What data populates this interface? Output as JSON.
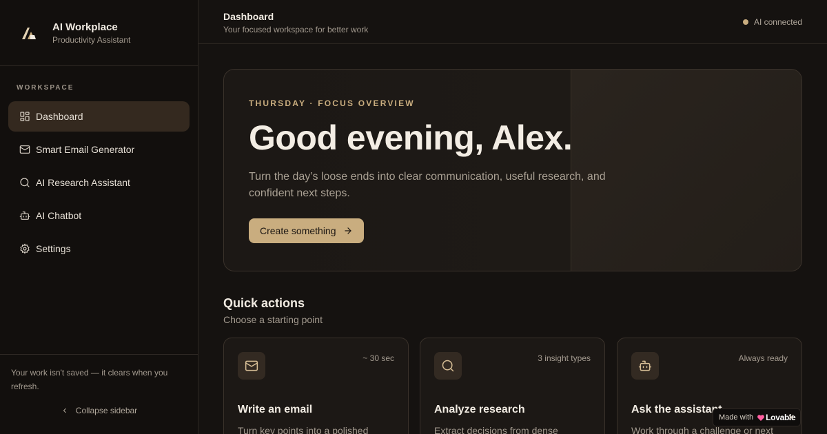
{
  "brand": {
    "title": "AI Workplace",
    "subtitle": "Productivity Assistant",
    "logo_icon": "workplace-logo-icon"
  },
  "sidebar": {
    "section_label": "WORKSPACE",
    "items": [
      {
        "label": "Dashboard",
        "icon": "grid-icon",
        "active": true
      },
      {
        "label": "Smart Email Generator",
        "icon": "mail-icon"
      },
      {
        "label": "AI Research Assistant",
        "icon": "search-icon"
      },
      {
        "label": "AI Chatbot",
        "icon": "bot-icon"
      },
      {
        "label": "Settings",
        "icon": "gear-icon"
      }
    ],
    "footer_note": "Your work isn't saved — it clears when you refresh.",
    "collapse_label": "Collapse sidebar"
  },
  "header": {
    "title": "Dashboard",
    "subtitle": "Your focused workspace for better work",
    "status": "AI connected"
  },
  "hero": {
    "eyebrow": "THURSDAY · FOCUS OVERVIEW",
    "greeting": "Good evening, Alex.",
    "text": "Turn the day’s loose ends into clear communication, useful research, and confident next steps.",
    "cta_label": "Create something"
  },
  "quick_actions": {
    "title": "Quick actions",
    "subtitle": "Choose a starting point",
    "cards": [
      {
        "meta": "~ 30 sec",
        "title": "Write an email",
        "desc": "Turn key points into a polished",
        "icon": "mail-icon"
      },
      {
        "meta": "3 insight types",
        "title": "Analyze research",
        "desc": "Extract decisions from dense",
        "icon": "search-icon"
      },
      {
        "meta": "Always ready",
        "title": "Ask the assistant",
        "desc": "Work through a challenge or next",
        "icon": "bot-icon"
      }
    ]
  },
  "badge": {
    "prefix": "Made with",
    "brand": "Lovable",
    "close": "✕"
  },
  "colors": {
    "accent": "#c9ad7f",
    "background": "#151210",
    "sidebar": "#120f0d"
  }
}
